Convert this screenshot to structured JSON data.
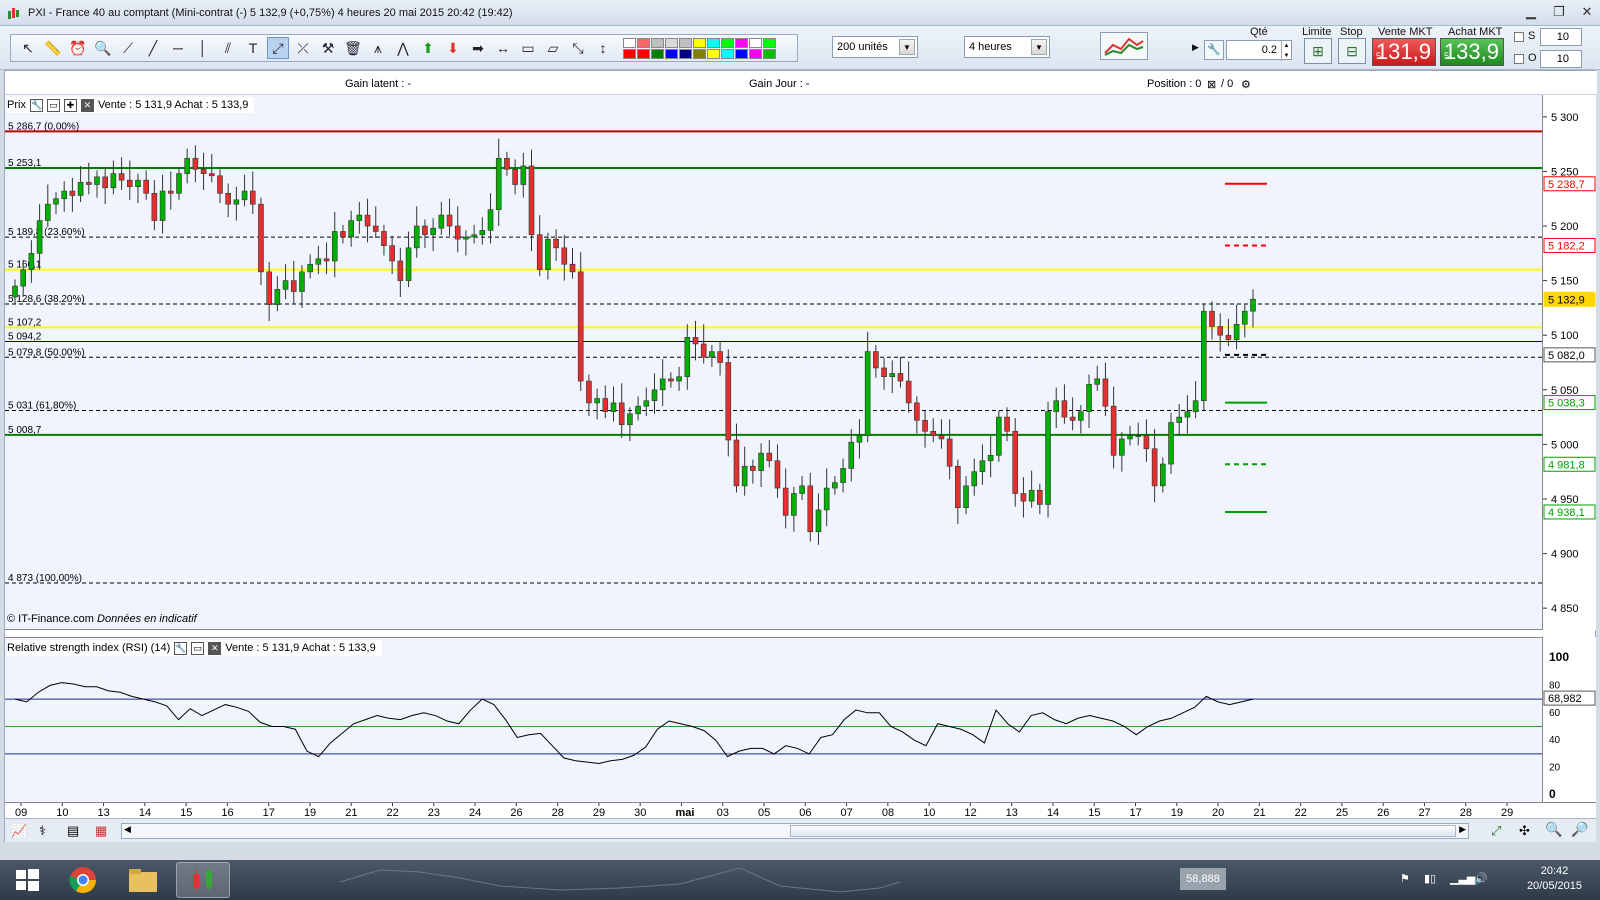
{
  "window": {
    "title": "PXI - France 40 au comptant (Mini-contrat  (-)    5 132,9 (+0,75%)    4 heures  20 mai 2015 20:42 (19:42)"
  },
  "toolbar": {
    "units_select": "200 unités",
    "period_select": "4 heures",
    "qty_label": "Qté",
    "qty_value": "0.2",
    "limit_label": "Limite",
    "stop_label": "Stop",
    "sell_label": "Vente MKT",
    "buy_label": "Achat MKT",
    "sell_small": "5",
    "sell_big": "131,9",
    "sell_sup": "9",
    "buy_small": "5",
    "buy_big": "133,9",
    "buy_sup": "9",
    "s_label": "S",
    "o_label": "O",
    "s_value": "10",
    "o_value": "10",
    "palette_colors": [
      "#ffffff",
      "#ff6666",
      "#c0c0c0",
      "#d9d9d9",
      "#bfbfbf",
      "#ffff00",
      "#00ffff",
      "#00ff00",
      "#ff00ff",
      "#ffffff",
      "#00ff00",
      "#ff0000",
      "#ff0000",
      "#008000",
      "#0000ff",
      "#000080",
      "#808000",
      "#ffff00",
      "#00ffff",
      "#0000ff",
      "#ff00ff",
      "#00c000"
    ]
  },
  "gain_bar": {
    "latent": "Gain latent : -",
    "jour": "Gain Jour : -",
    "position": "Position : 0",
    "position_tail": "/ 0"
  },
  "main_pane": {
    "title": "Prix",
    "quote": "Vente : 5 131,9 Achat : 5 133,9",
    "watermark": "© IT-Finance.com",
    "watermark_note": "Données en indicatif"
  },
  "rsi_pane": {
    "title": "Relative strength index (RSI) (14)",
    "quote": "Vente : 5 131,9 Achat : 5 133,9",
    "last_value": "68,982"
  },
  "chart_data": [
    {
      "type": "candlestick",
      "title": "PXI - France 40 au comptant (Mini-contrat  (-)",
      "ylim": [
        4830,
        5320
      ],
      "price_axis_ticks": [
        "5 300",
        "5 250",
        "5 200",
        "5 150",
        "5 100",
        "5 050",
        "5 000",
        "4 950",
        "4 900",
        "4 850"
      ],
      "x_ticks": [
        "09",
        "10",
        "13",
        "14",
        "15",
        "16",
        "17",
        "19",
        "21",
        "22",
        "23",
        "24",
        "26",
        "28",
        "29",
        "30",
        "mai",
        "03",
        "05",
        "06",
        "07",
        "08",
        "10",
        "12",
        "13",
        "14",
        "15",
        "17",
        "19",
        "20",
        "21",
        "22",
        "25",
        "26",
        "27",
        "28",
        "29"
      ],
      "horizontal_lines": [
        {
          "label": "5 286,7 (0,00%)",
          "value": 5286.7,
          "color": "#c00000"
        },
        {
          "label": "5 253,1",
          "value": 5253.1,
          "color": "#008000"
        },
        {
          "label": "5 189,8 (23,60%)",
          "value": 5189.8,
          "color": "#000000"
        },
        {
          "label": "5 160,1",
          "value": 5160.1,
          "color": "#ffff00"
        },
        {
          "label": "5 128,6 (38,20%)",
          "value": 5128.6,
          "color": "#000000"
        },
        {
          "label": "5 107,2",
          "value": 5107.2,
          "color": "#ffff00"
        },
        {
          "label": "5 094,2",
          "value": 5094.2,
          "color": "#000080"
        },
        {
          "label": "5 079,8 (50,00%)",
          "value": 5079.8,
          "color": "#000000"
        },
        {
          "label": "5 031 (61,80%)",
          "value": 5031,
          "color": "#000000"
        },
        {
          "label": "5 008,7",
          "value": 5008.7,
          "color": "#008000"
        },
        {
          "label": "4 873 (100,00%)",
          "value": 4873,
          "color": "#000000"
        }
      ],
      "price_tags": [
        {
          "label": "5 238,7",
          "value": 5238.7,
          "color": "#ff0000"
        },
        {
          "label": "5 182,2",
          "value": 5182.2,
          "color": "#ff0000"
        },
        {
          "label": "5 132,9",
          "value": 5132.9,
          "color": "#ffd700"
        },
        {
          "label": "5 082,0",
          "value": 5082.0,
          "color": "#000000"
        },
        {
          "label": "5 038,3",
          "value": 5038.3,
          "color": "#00a000"
        },
        {
          "label": "4 981,8",
          "value": 4981.8,
          "color": "#00a000"
        },
        {
          "label": "4 938,1",
          "value": 4938.1,
          "color": "#00a000"
        }
      ],
      "closes": [
        5145,
        5160,
        5175,
        5205,
        5220,
        5225,
        5232,
        5228,
        5240,
        5238,
        5245,
        5235,
        5248,
        5242,
        5236,
        5242,
        5230,
        5205,
        5232,
        5230,
        5248,
        5262,
        5252,
        5248,
        5246,
        5230,
        5220,
        5224,
        5232,
        5220,
        5158,
        5128,
        5142,
        5150,
        5140,
        5158,
        5165,
        5170,
        5168,
        5195,
        5190,
        5205,
        5210,
        5200,
        5195,
        5182,
        5168,
        5150,
        5180,
        5200,
        5192,
        5198,
        5210,
        5200,
        5188,
        5190,
        5192,
        5196,
        5215,
        5262,
        5252,
        5238,
        5255,
        5192,
        5160,
        5188,
        5180,
        5165,
        5158,
        5058,
        5038,
        5042,
        5030,
        5038,
        5018,
        5028,
        5035,
        5040,
        5050,
        5060,
        5058,
        5062,
        5098,
        5092,
        5080,
        5085,
        5075,
        5004,
        4962,
        4980,
        4976,
        4992,
        4985,
        4960,
        4935,
        4955,
        4962,
        4920,
        4940,
        4960,
        4965,
        4978,
        5002,
        5008,
        5085,
        5070,
        5062,
        5065,
        5058,
        5038,
        5022,
        5012,
        5008,
        5005,
        4980,
        4942,
        4962,
        4975,
        4985,
        4990,
        5025,
        5012,
        4955,
        4948,
        4958,
        4945,
        5030,
        5040,
        5025,
        5022,
        5030,
        5055,
        5060,
        5035,
        4990,
        5005,
        5008,
        5008,
        4996,
        4962,
        4982,
        5020,
        5025,
        5030,
        5040,
        5122,
        5108,
        5100,
        5096,
        5110,
        5122,
        5133
      ]
    },
    {
      "type": "line",
      "title": "Relative strength index (RSI) (14)",
      "ylim": [
        0,
        100
      ],
      "y_ticks": [
        "100",
        "80",
        "60",
        "40",
        "20",
        "0"
      ],
      "bands": [
        30,
        50,
        70
      ],
      "values": [
        70,
        68,
        75,
        80,
        82,
        81,
        79,
        79,
        76,
        75,
        72,
        70,
        68,
        65,
        55,
        63,
        58,
        62,
        66,
        64,
        61,
        53,
        50,
        50,
        48,
        32,
        28,
        38,
        45,
        52,
        55,
        58,
        56,
        55,
        58,
        60,
        58,
        54,
        52,
        62,
        70,
        66,
        55,
        42,
        44,
        45,
        36,
        27,
        25,
        24,
        23,
        25,
        26,
        29,
        35,
        48,
        54,
        52,
        50,
        47,
        40,
        28,
        32,
        34,
        34,
        30,
        36,
        34,
        30,
        42,
        44,
        55,
        62,
        60,
        60,
        50,
        46,
        40,
        36,
        52,
        50,
        48,
        44,
        38,
        62,
        52,
        46,
        58,
        60,
        55,
        52,
        56,
        58,
        56,
        54,
        50,
        44,
        50,
        54,
        56,
        60,
        64,
        72,
        68,
        66,
        68,
        70
      ]
    }
  ],
  "taskbar": {
    "tray_value": "58,888",
    "time": "20:42",
    "date": "20/05/2015"
  }
}
